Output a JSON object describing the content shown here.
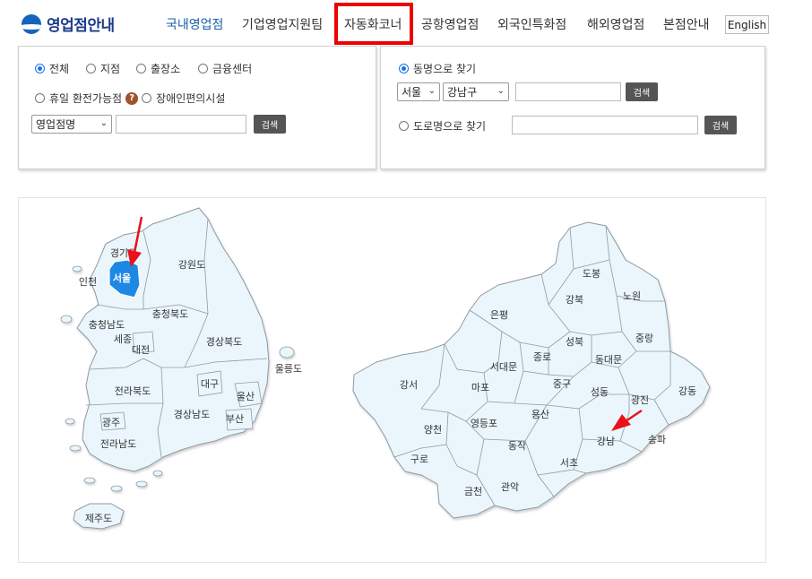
{
  "header": {
    "logo_text": "영업점안내",
    "nav": [
      {
        "label": "국내영업점",
        "active": true
      },
      {
        "label": "기업영업지원팀",
        "active": false
      },
      {
        "label": "자동화코너",
        "active": false
      },
      {
        "label": "공항영업점",
        "active": false
      },
      {
        "label": "외국인특화점",
        "active": false
      },
      {
        "label": "해외영업점",
        "active": false
      },
      {
        "label": "본점안내",
        "active": false
      }
    ],
    "lang_button": "English"
  },
  "left_panel": {
    "type_radios": [
      {
        "label": "전체",
        "checked": true
      },
      {
        "label": "지점",
        "checked": false
      },
      {
        "label": "출장소",
        "checked": false
      },
      {
        "label": "금융센터",
        "checked": false
      }
    ],
    "holiday_radio": {
      "label": "휴일 환전가능점",
      "checked": false
    },
    "help_icon_glyph": "?",
    "accessible_radio": {
      "label": "장애인편의시설",
      "checked": false
    },
    "search_select": "영업점명",
    "search_input_value": "",
    "search_button": "검색"
  },
  "right_panel": {
    "dong_radio": {
      "label": "동명으로 찾기",
      "checked": true
    },
    "city_select": "서울",
    "district_select": "강남구",
    "dong_input_value": "",
    "dong_search_button": "검색",
    "road_radio": {
      "label": "도로명으로 찾기",
      "checked": false
    },
    "road_input_value": "",
    "road_search_button": "검색"
  },
  "korea_map": {
    "regions": [
      "경기도",
      "서울",
      "인천",
      "강원도",
      "충청북도",
      "충청남도",
      "세종",
      "대전",
      "경상북도",
      "울릉도",
      "전라북도",
      "대구",
      "울산",
      "광주",
      "경상남도",
      "부산",
      "전라남도",
      "제주도"
    ],
    "selected": "서울"
  },
  "seoul_map": {
    "districts": [
      "도봉",
      "강북",
      "노원",
      "은평",
      "성북",
      "중랑",
      "종로",
      "서대문",
      "동대문",
      "강서",
      "마포",
      "중구",
      "성동",
      "광진",
      "강동",
      "양천",
      "영등포",
      "용산",
      "강남",
      "송파",
      "구로",
      "동작",
      "서초",
      "금천",
      "관악"
    ],
    "selected": "강남"
  },
  "colors": {
    "map_fill": "#eaf6fb",
    "map_stroke": "#8e9aa4",
    "selected_fill": "#1e88e5",
    "arrow": "#e8121b",
    "nav_active": "#1b5fa8",
    "highlight_box": "#ee0000"
  }
}
